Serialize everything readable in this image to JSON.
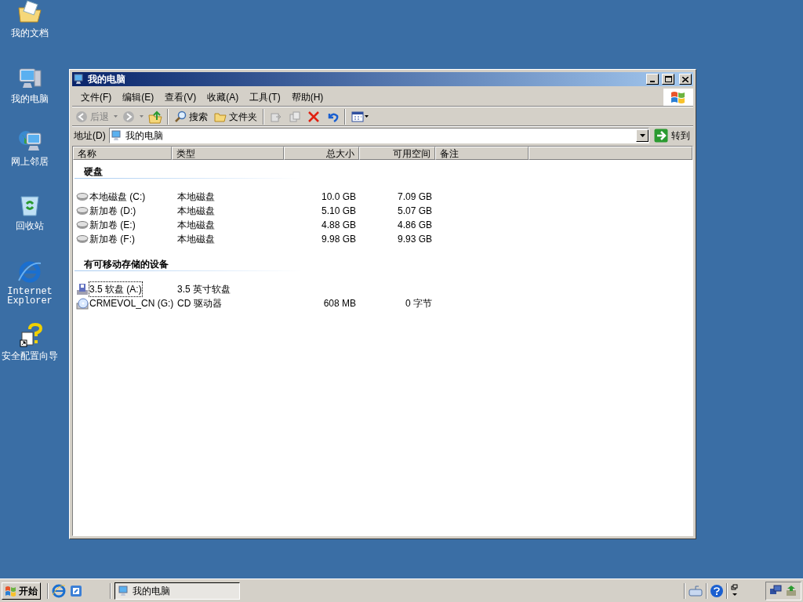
{
  "desktop_icons": [
    {
      "label": "我的文档",
      "kind": "documents"
    },
    {
      "label": "我的电脑",
      "kind": "computer"
    },
    {
      "label": "网上邻居",
      "kind": "network"
    },
    {
      "label": "回收站",
      "kind": "recycle"
    },
    {
      "label": "Internet Explorer",
      "kind": "ie"
    },
    {
      "label": "安全配置向导",
      "kind": "wizard"
    }
  ],
  "window": {
    "title": "我的电脑",
    "menu": [
      "文件(F)",
      "编辑(E)",
      "查看(V)",
      "收藏(A)",
      "工具(T)",
      "帮助(H)"
    ],
    "toolbar": {
      "back": "后退",
      "search": "搜索",
      "folders": "文件夹"
    },
    "address": {
      "label": "地址(D)",
      "value": "我的电脑",
      "go": "转到"
    },
    "columns": [
      "名称",
      "类型",
      "总大小",
      "可用空间",
      "备注"
    ],
    "groups": [
      {
        "title": "硬盘",
        "items": [
          {
            "name": "本地磁盘 (C:)",
            "type": "本地磁盘",
            "total": "10.0 GB",
            "free": "7.09 GB",
            "kind": "disk",
            "selected": false
          },
          {
            "name": "新加卷 (D:)",
            "type": "本地磁盘",
            "total": "5.10 GB",
            "free": "5.07 GB",
            "kind": "disk",
            "selected": false
          },
          {
            "name": "新加卷 (E:)",
            "type": "本地磁盘",
            "total": "4.88 GB",
            "free": "4.86 GB",
            "kind": "disk",
            "selected": false
          },
          {
            "name": "新加卷 (F:)",
            "type": "本地磁盘",
            "total": "9.98 GB",
            "free": "9.93 GB",
            "kind": "disk",
            "selected": false
          }
        ]
      },
      {
        "title": "有可移动存储的设备",
        "items": [
          {
            "name": "3.5 软盘 (A:)",
            "type": "3.5 英寸软盘",
            "kind": "floppy",
            "selected": true
          },
          {
            "name": "CRMEVOL_CN (G:)",
            "type": "CD 驱动器",
            "total": "608 MB",
            "free": "0 字节",
            "kind": "cd",
            "selected": false
          }
        ]
      }
    ]
  },
  "taskbar": {
    "start": "开始",
    "tasks": [
      {
        "label": "我的电脑",
        "selected": true
      }
    ]
  }
}
